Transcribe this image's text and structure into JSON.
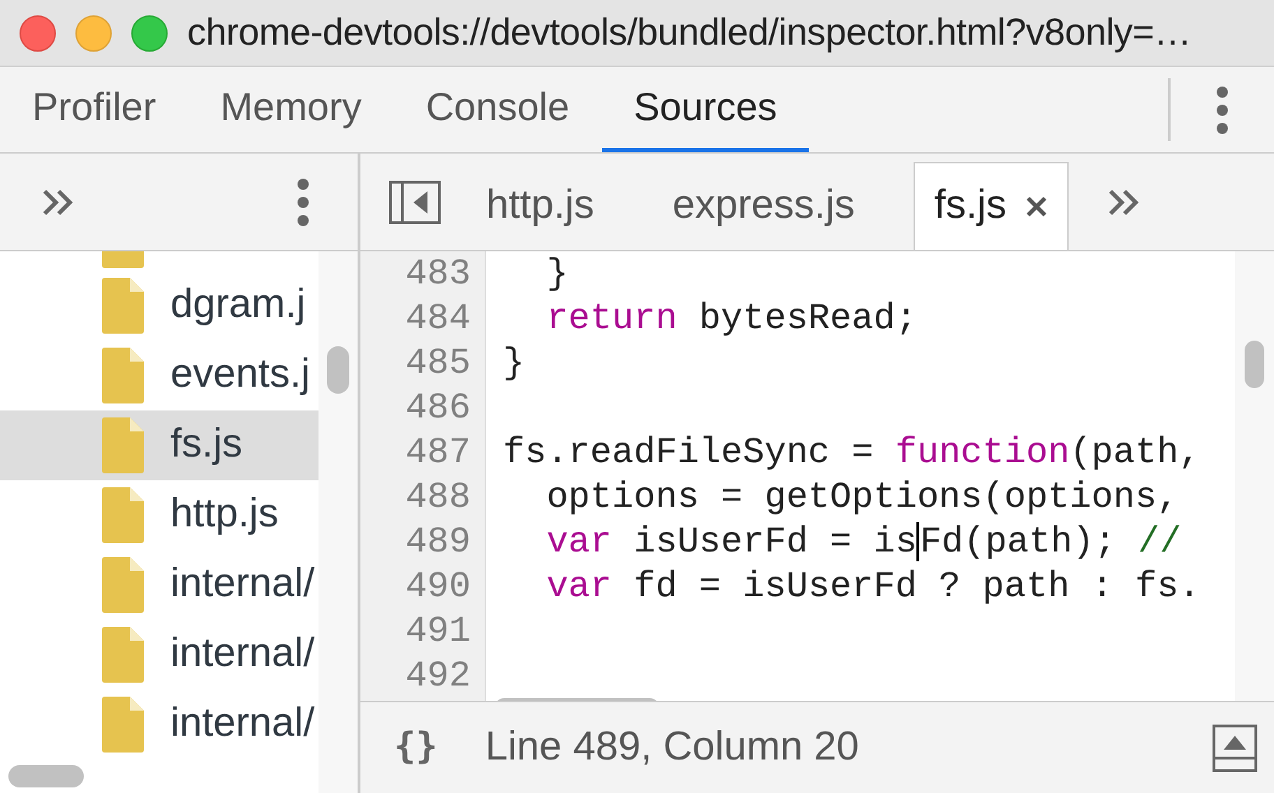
{
  "window": {
    "title": "chrome-devtools://devtools/bundled/inspector.html?v8only=…"
  },
  "panel_tabs": [
    {
      "label": "Profiler",
      "selected": false
    },
    {
      "label": "Memory",
      "selected": false
    },
    {
      "label": "Console",
      "selected": false
    },
    {
      "label": "Sources",
      "selected": true
    }
  ],
  "navigator": {
    "files": [
      {
        "label": "dgram.j",
        "selected": false
      },
      {
        "label": "events.j",
        "selected": false
      },
      {
        "label": "fs.js",
        "selected": true
      },
      {
        "label": "http.js",
        "selected": false
      },
      {
        "label": "internal/",
        "selected": false
      },
      {
        "label": "internal/",
        "selected": false
      },
      {
        "label": "internal/",
        "selected": false
      }
    ]
  },
  "editor_tabs": [
    {
      "label": "http.js",
      "selected": false
    },
    {
      "label": "express.js",
      "selected": false
    },
    {
      "label": "fs.js",
      "selected": true
    }
  ],
  "code": [
    {
      "number": "483",
      "tokens": [
        {
          "kind": "indent"
        },
        {
          "kind": "plain",
          "text": "}"
        }
      ]
    },
    {
      "number": "484",
      "tokens": [
        {
          "kind": "indent"
        },
        {
          "kind": "keyword",
          "text": "return"
        },
        {
          "kind": "plain",
          "text": " bytesRead;"
        }
      ]
    },
    {
      "number": "485",
      "tokens": [
        {
          "kind": "plain",
          "text": "}"
        }
      ]
    },
    {
      "number": "486"
    },
    {
      "number": "487",
      "tokens": [
        {
          "kind": "plain",
          "text": "fs.readFileSync = "
        },
        {
          "kind": "keyword",
          "text": "function"
        },
        {
          "kind": "plain",
          "text": "(path,"
        }
      ]
    },
    {
      "number": "488",
      "tokens": [
        {
          "kind": "indent"
        },
        {
          "kind": "plain",
          "text": "options = getOptions(options,"
        }
      ]
    },
    {
      "number": "489",
      "tokens": [
        {
          "kind": "indent"
        },
        {
          "kind": "keyword",
          "text": "var"
        },
        {
          "kind": "plain",
          "text": " isUserFd = is"
        },
        {
          "kind": "cursor"
        },
        {
          "kind": "plain",
          "text": "Fd(path); "
        },
        {
          "kind": "comment",
          "text": "//"
        }
      ]
    },
    {
      "number": "490",
      "tokens": [
        {
          "kind": "indent"
        },
        {
          "kind": "keyword",
          "text": "var"
        },
        {
          "kind": "plain",
          "text": " fd = isUserFd ? path : fs."
        }
      ]
    },
    {
      "number": "491"
    },
    {
      "number": "492"
    }
  ],
  "status_bar": {
    "format_button": "{}",
    "position": "Line 489, Column 20"
  }
}
